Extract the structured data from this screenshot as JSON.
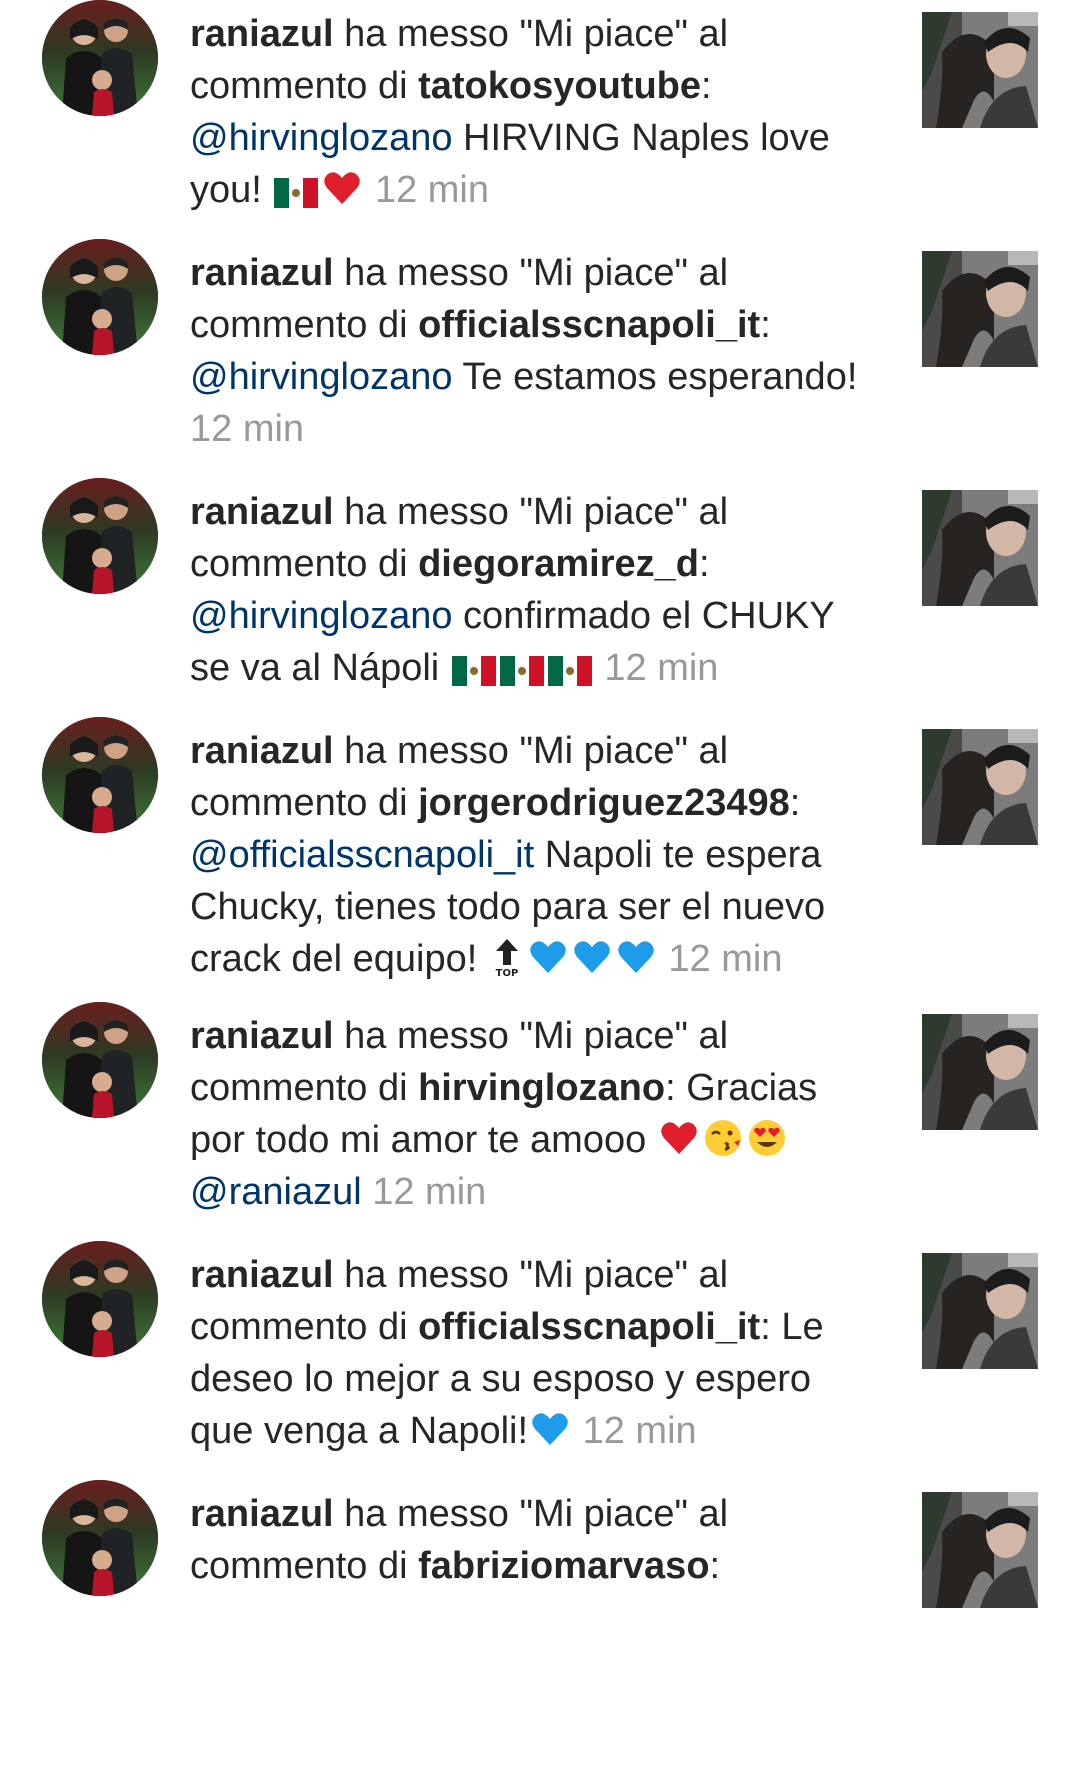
{
  "colors": {
    "text": "#262626",
    "mention": "#003569",
    "timestamp": "#999999",
    "background": "#ffffff"
  },
  "notifications": [
    {
      "actor": "raniazul",
      "action": " ha messo \"Mi piace\" al commento di ",
      "target": "tatokosyoutube",
      "colon": ":",
      "mention": "@hirvinglozano",
      "comment": " HIRVING Naples love you! ",
      "emojis": [
        "flag-mexico",
        "red-heart"
      ],
      "after_emojis": "",
      "time": "12 min",
      "avatar_icon": "profile-photo-family",
      "thumb_icon": "post-thumbnail-couple"
    },
    {
      "actor": "raniazul",
      "action": " ha messo \"Mi piace\" al commento di ",
      "target": "officialsscnapoli_it",
      "colon": ":",
      "mention": "@hirvinglozano",
      "comment": " Te estamos esperando! ",
      "emojis": [],
      "after_emojis": "",
      "time": "12 min",
      "avatar_icon": "profile-photo-family",
      "thumb_icon": "post-thumbnail-couple"
    },
    {
      "actor": "raniazul",
      "action": " ha messo \"Mi piace\" al commento di ",
      "target": "diegoramirez_d",
      "colon": ":",
      "mention": "@hirvinglozano",
      "comment": " confirmado el CHUKY se va al Nápoli ",
      "emojis": [
        "flag-mexico",
        "flag-mexico",
        "flag-mexico"
      ],
      "after_emojis": "",
      "time": "12 min",
      "avatar_icon": "profile-photo-family",
      "thumb_icon": "post-thumbnail-couple"
    },
    {
      "actor": "raniazul",
      "action": " ha messo \"Mi piace\" al commento di ",
      "target": "jorgerodriguez23498",
      "colon": ":",
      "mention": "@officialsscnapoli_it",
      "comment": " Napoli te espera Chucky, tienes todo para ser el nuevo crack del equipo! ",
      "emojis": [
        "top-arrow",
        "blue-heart",
        "blue-heart",
        "blue-heart"
      ],
      "after_emojis": "",
      "time": "12 min",
      "avatar_icon": "profile-photo-family",
      "thumb_icon": "post-thumbnail-couple"
    },
    {
      "actor": "raniazul",
      "action": " ha messo \"Mi piace\" al commento di ",
      "target": "hirvinglozano",
      "colon": ":",
      "mention": "",
      "comment": " Gracias por todo mi amor te amooo ",
      "emojis": [
        "red-heart",
        "kiss-face",
        "heart-eyes-face"
      ],
      "after_emojis": " ",
      "after_mention": "@raniazul",
      "time": "12 min",
      "avatar_icon": "profile-photo-family",
      "thumb_icon": "post-thumbnail-couple"
    },
    {
      "actor": "raniazul",
      "action": " ha messo \"Mi piace\" al commento di ",
      "target": "officialsscnapoli_it",
      "colon": ":",
      "mention": "",
      "comment": " Le deseo lo mejor a su esposo y espero que venga a Napoli!",
      "emojis": [
        "blue-heart"
      ],
      "after_emojis": "",
      "time": "12 min",
      "avatar_icon": "profile-photo-family",
      "thumb_icon": "post-thumbnail-couple"
    },
    {
      "actor": "raniazul",
      "action": " ha messo \"Mi piace\" al commento di ",
      "target": "fabriziomarvaso",
      "colon": ":",
      "mention": "",
      "comment": "",
      "emojis": [],
      "after_emojis": "",
      "time": "",
      "avatar_icon": "profile-photo-family",
      "thumb_icon": "post-thumbnail-couple"
    }
  ]
}
